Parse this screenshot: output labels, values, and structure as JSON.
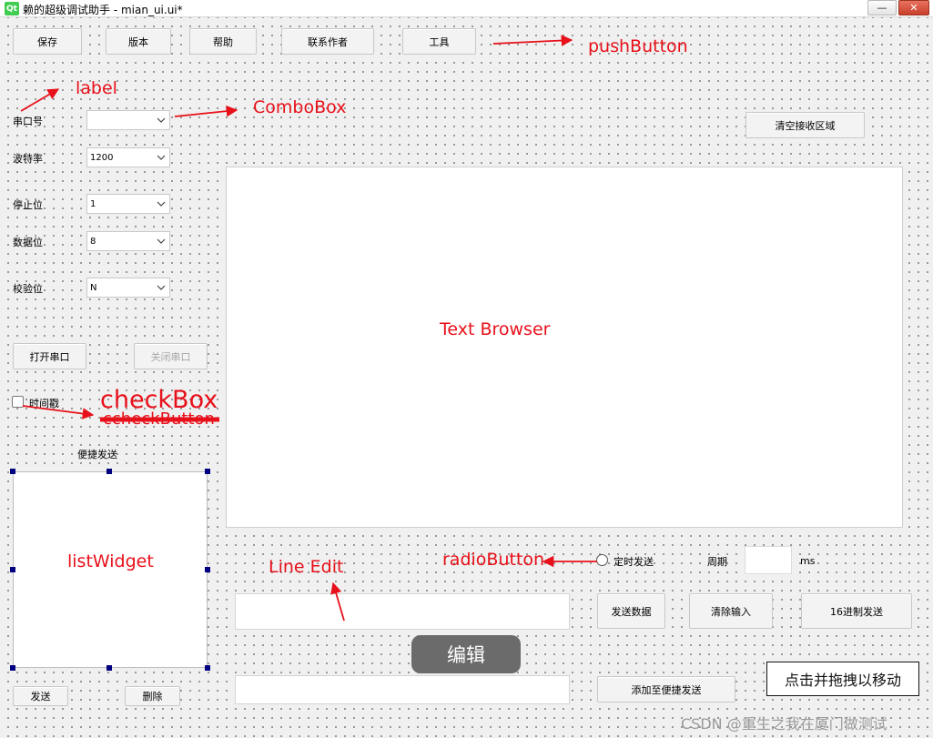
{
  "window": {
    "logo": "Qt",
    "title": "赖的超级调试助手 - mian_ui.ui*",
    "minimize_glyph": "—",
    "close_glyph": "✕"
  },
  "toolbar": {
    "save": "保存",
    "version": "版本",
    "help": "帮助",
    "contact": "联系作者",
    "tools": "工具"
  },
  "serial": {
    "port_label": "串口号",
    "port_value": "",
    "baud_label": "波特率",
    "baud_value": "1200",
    "stop_label": "停止位",
    "stop_value": "1",
    "data_label": "数据位",
    "data_value": "8",
    "parity_label": "校验位",
    "parity_value": "N",
    "open_button": "打开串口",
    "close_button": "关闭串口",
    "timestamp_label": "时间戳",
    "timestamp_checked": false
  },
  "quick_send": {
    "title": "便捷发送",
    "send_button": "发送",
    "delete_button": "删除"
  },
  "receive": {
    "clear_button": "清空接收区域"
  },
  "send": {
    "timed_label": "定时发送",
    "period_label": "周期",
    "period_value": "",
    "period_unit": "ms",
    "send_data_button": "发送数据",
    "clear_input_button": "清除输入",
    "hex_send_button": "16进制发送",
    "add_quick_button": "添加至便捷发送"
  },
  "annotations": {
    "pushbutton": "pushButton",
    "label": "label",
    "combobox": "ComboBox",
    "text_browser": "Text Browser",
    "checkbox": "checkBox",
    "checkbutton": "ccheckButton",
    "list_widget": "listWidget",
    "line_edit": "Line Edit",
    "radio_button": "radioButton",
    "edit_badge": "编辑",
    "drag_hint": "点击并拖拽以移动",
    "watermark": "CSDN @重生之我在厦门做测试",
    "color": "#e8101a"
  }
}
